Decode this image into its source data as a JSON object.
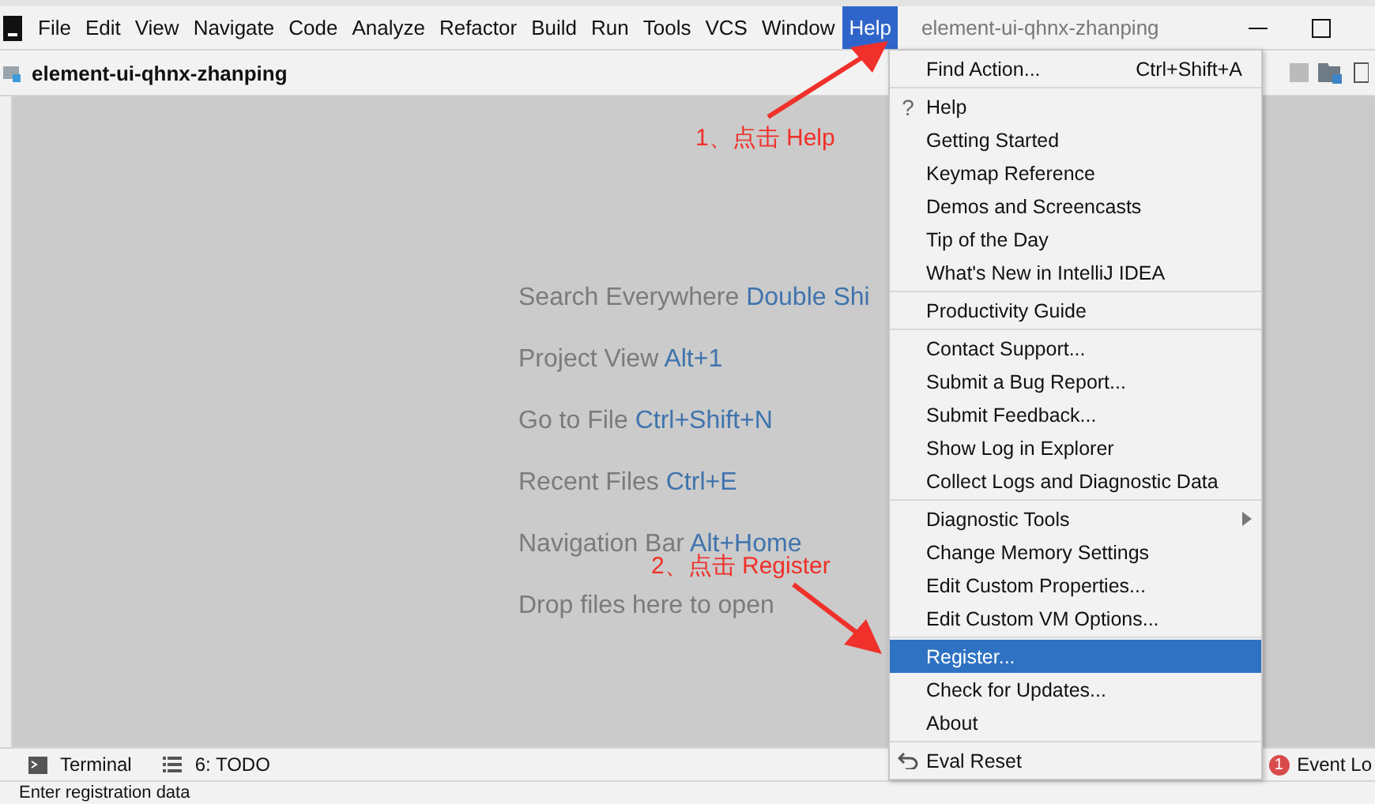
{
  "menu_bar": {
    "items": [
      {
        "label": "File",
        "selected": false
      },
      {
        "label": "Edit",
        "selected": false
      },
      {
        "label": "View",
        "selected": false
      },
      {
        "label": "Navigate",
        "selected": false
      },
      {
        "label": "Code",
        "selected": false
      },
      {
        "label": "Analyze",
        "selected": false
      },
      {
        "label": "Refactor",
        "selected": false
      },
      {
        "label": "Build",
        "selected": false
      },
      {
        "label": "Run",
        "selected": false
      },
      {
        "label": "Tools",
        "selected": false
      },
      {
        "label": "VCS",
        "selected": false
      },
      {
        "label": "Window",
        "selected": false
      },
      {
        "label": "Help",
        "selected": true
      }
    ],
    "window_title": "element-ui-qhnx-zhanping"
  },
  "navigation_bar": {
    "project": "element-ui-qhnx-zhanping"
  },
  "hints": [
    {
      "label": "Search Everywhere",
      "shortcut": "Double Shi"
    },
    {
      "label": "Project View",
      "shortcut": "Alt+1"
    },
    {
      "label": "Go to File",
      "shortcut": "Ctrl+Shift+N"
    },
    {
      "label": "Recent Files",
      "shortcut": "Ctrl+E"
    },
    {
      "label": "Navigation Bar",
      "shortcut": "Alt+Home"
    },
    {
      "label": "Drop files here to open"
    }
  ],
  "help_menu": {
    "sections": [
      [
        {
          "label": "Find Action...",
          "shortcut": "Ctrl+Shift+A",
          "selected": false
        }
      ],
      [
        {
          "label": "Help",
          "icon": "?",
          "selected": false
        },
        {
          "label": "Getting Started",
          "selected": false
        },
        {
          "label": "Keymap Reference",
          "selected": false
        },
        {
          "label": "Demos and Screencasts",
          "selected": false
        },
        {
          "label": "Tip of the Day",
          "selected": false
        },
        {
          "label": "What's New in IntelliJ IDEA",
          "selected": false
        }
      ],
      [
        {
          "label": "Productivity Guide",
          "selected": false
        }
      ],
      [
        {
          "label": "Contact Support...",
          "selected": false
        },
        {
          "label": "Submit a Bug Report...",
          "selected": false
        },
        {
          "label": "Submit Feedback...",
          "selected": false
        },
        {
          "label": "Show Log in Explorer",
          "selected": false
        },
        {
          "label": "Collect Logs and Diagnostic Data",
          "selected": false
        }
      ],
      [
        {
          "label": "Diagnostic Tools",
          "submenu": true,
          "selected": false
        },
        {
          "label": "Change Memory Settings",
          "selected": false
        },
        {
          "label": "Edit Custom Properties...",
          "selected": false
        },
        {
          "label": "Edit Custom VM Options...",
          "selected": false
        }
      ],
      [
        {
          "label": "Register...",
          "selected": true
        },
        {
          "label": "Check for Updates...",
          "selected": false
        },
        {
          "label": "About",
          "selected": false
        }
      ],
      [
        {
          "label": "Eval Reset",
          "kind": "undo",
          "selected": false
        }
      ]
    ]
  },
  "annotations": [
    {
      "text": "1、点击 Help"
    },
    {
      "text": "2、点击 Register"
    }
  ],
  "tool_windows": [
    {
      "label": "Terminal",
      "kind": "terminal"
    },
    {
      "label": "6: TODO",
      "kind": "todo"
    }
  ],
  "event_log": {
    "count": "1",
    "label": "Event Lo"
  },
  "status_bar": {
    "text": "Enter registration data"
  }
}
